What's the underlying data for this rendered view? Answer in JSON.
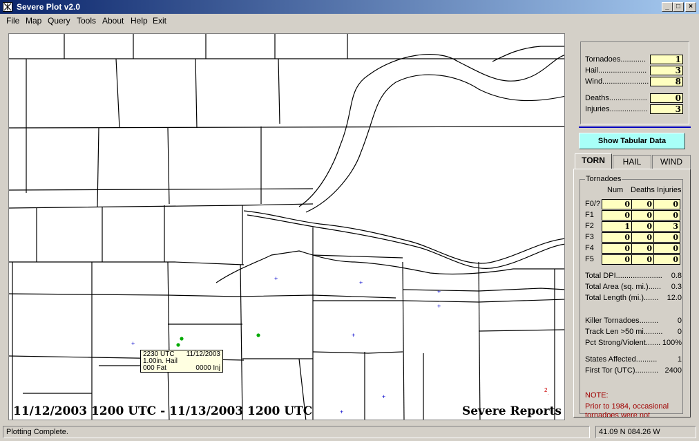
{
  "window": {
    "title": "Severe Plot v2.0",
    "minimize": "_",
    "maximize": "□",
    "close": "×"
  },
  "menu": [
    "File",
    "Map",
    "Query",
    "Tools",
    "About",
    "Help",
    "Exit"
  ],
  "map": {
    "date_range": "11/12/2003 1200 UTC - 11/13/2003 1200 UTC",
    "caption": "Severe Reports",
    "tooltip": {
      "time": "2230 UTC",
      "date": "11/12/2003",
      "desc": "1.00in. Hail",
      "fat": "000 Fat",
      "inj": "0000 Inj"
    },
    "red_marker_text": "2",
    "colors": {
      "wind": "#0000cc",
      "hail": "#00aa00",
      "tornado": "#cc0000"
    }
  },
  "summary": {
    "tornadoes_label": "Tornadoes............",
    "tornadoes": "1",
    "hail_label": "Hail.......................",
    "hail": "3",
    "wind_label": "Wind......................",
    "wind": "8",
    "deaths_label": "Deaths..................",
    "deaths": "0",
    "injuries_label": "Injuries..................",
    "injuries": "3"
  },
  "show_tabular_button": "Show Tabular Data",
  "tabs": {
    "torn": "TORN",
    "hail": "HAIL",
    "wind": "WIND"
  },
  "torn_panel": {
    "group_title": "Tornadoes",
    "col_num": "Num",
    "col_deaths": "Deaths",
    "col_injuries": "Injuries",
    "rows": [
      {
        "label": "F0/?",
        "num": "0",
        "deaths": "0",
        "injuries": "0"
      },
      {
        "label": "F1",
        "num": "0",
        "deaths": "0",
        "injuries": "0"
      },
      {
        "label": "F2",
        "num": "1",
        "deaths": "0",
        "injuries": "3"
      },
      {
        "label": "F3",
        "num": "0",
        "deaths": "0",
        "injuries": "0"
      },
      {
        "label": "F4",
        "num": "0",
        "deaths": "0",
        "injuries": "0"
      },
      {
        "label": "F5",
        "num": "0",
        "deaths": "0",
        "injuries": "0"
      }
    ],
    "stats": [
      {
        "label": "Total DPI......................",
        "value": "0.8"
      },
      {
        "label": "Total Area (sq. mi.)......",
        "value": "0.3"
      },
      {
        "label": "Total Length (mi.).......",
        "value": "12.0"
      },
      {
        "label": "Killer Tornadoes.........",
        "value": "0"
      },
      {
        "label": "Track Len >50 mi.........",
        "value": "0"
      },
      {
        "label": "Pct Strong/Violent.......",
        "value": "100%"
      },
      {
        "label": "States Affected..........",
        "value": "1"
      },
      {
        "label": "First Tor (UTC)...........",
        "value": "2400"
      }
    ],
    "note_title": "NOTE:",
    "note_text": "Prior to 1984, occasional tornadoes were not"
  },
  "status": {
    "message": "Plotting Complete.",
    "coords": "41.09 N   084.26 W"
  }
}
